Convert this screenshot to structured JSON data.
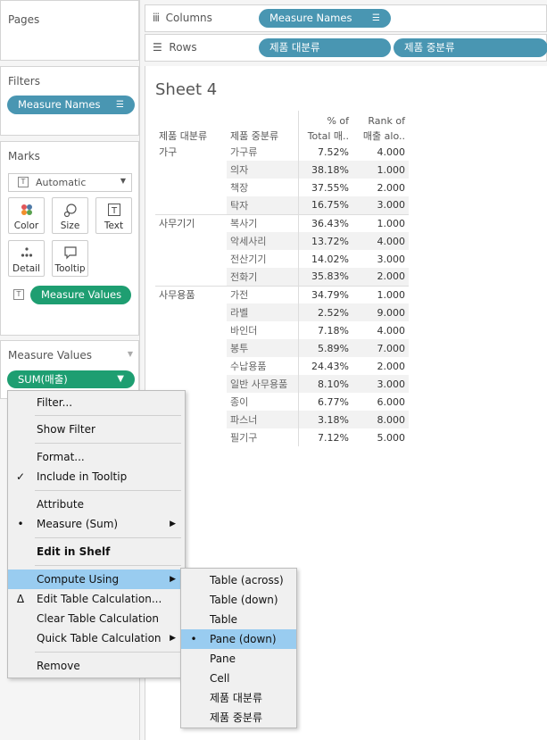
{
  "pages": {
    "title": "Pages"
  },
  "filters": {
    "title": "Filters",
    "pill": "Measure Names"
  },
  "marks": {
    "title": "Marks",
    "type": "Automatic",
    "buttons": {
      "color": "Color",
      "size": "Size",
      "text": "Text",
      "detail": "Detail",
      "tooltip": "Tooltip"
    },
    "text_pill": "Measure Values"
  },
  "measure_values": {
    "title": "Measure Values",
    "pill": "SUM(매출)"
  },
  "columns": {
    "label": "Columns",
    "pill": "Measure Names"
  },
  "rows": {
    "label": "Rows",
    "pills": [
      "제품 대분류",
      "제품 중분류"
    ]
  },
  "sheet": {
    "title": "Sheet 4",
    "headers": {
      "col1": "제품 대분류",
      "col2": "제품 중분류",
      "col3_line1": "% of",
      "col3_line2": "Total 매..",
      "col4_line1": "Rank of",
      "col4_line2": "매출 alo.."
    },
    "rows": [
      {
        "cat": "가구",
        "sub": "가구류",
        "pct": "7.52%",
        "rank": "4.000"
      },
      {
        "cat": "",
        "sub": "의자",
        "pct": "38.18%",
        "rank": "1.000"
      },
      {
        "cat": "",
        "sub": "책장",
        "pct": "37.55%",
        "rank": "2.000"
      },
      {
        "cat": "",
        "sub": "탁자",
        "pct": "16.75%",
        "rank": "3.000"
      },
      {
        "cat": "사무기기",
        "sub": "복사기",
        "pct": "36.43%",
        "rank": "1.000"
      },
      {
        "cat": "",
        "sub": "악세사리",
        "pct": "13.72%",
        "rank": "4.000"
      },
      {
        "cat": "",
        "sub": "전산기기",
        "pct": "14.02%",
        "rank": "3.000"
      },
      {
        "cat": "",
        "sub": "전화기",
        "pct": "35.83%",
        "rank": "2.000"
      },
      {
        "cat": "사무용품",
        "sub": "가전",
        "pct": "34.79%",
        "rank": "1.000"
      },
      {
        "cat": "",
        "sub": "라벨",
        "pct": "2.52%",
        "rank": "9.000"
      },
      {
        "cat": "",
        "sub": "바인더",
        "pct": "7.18%",
        "rank": "4.000"
      },
      {
        "cat": "",
        "sub": "봉투",
        "pct": "5.89%",
        "rank": "7.000"
      },
      {
        "cat": "",
        "sub": "수납용품",
        "pct": "24.43%",
        "rank": "2.000"
      },
      {
        "cat": "",
        "sub": "일반 사무용품",
        "pct": "8.10%",
        "rank": "3.000"
      },
      {
        "cat": "",
        "sub": "종이",
        "pct": "6.77%",
        "rank": "6.000"
      },
      {
        "cat": "",
        "sub": "파스너",
        "pct": "3.18%",
        "rank": "8.000"
      },
      {
        "cat": "",
        "sub": "필기구",
        "pct": "7.12%",
        "rank": "5.000"
      }
    ]
  },
  "context_menu": {
    "items": {
      "filter": "Filter...",
      "show_filter": "Show Filter",
      "format": "Format...",
      "include_tooltip": "Include in Tooltip",
      "attribute": "Attribute",
      "measure_sum": "Measure (Sum)",
      "edit_in_shelf": "Edit in Shelf",
      "compute_using": "Compute Using",
      "edit_table_calc": "Edit Table Calculation...",
      "clear_table_calc": "Clear Table Calculation",
      "quick_table_calc": "Quick Table Calculation",
      "remove": "Remove"
    }
  },
  "submenu": {
    "items": [
      "Table (across)",
      "Table (down)",
      "Table",
      "Pane (down)",
      "Pane",
      "Cell",
      "제품 대분류",
      "제품 중분류"
    ],
    "selected": "Pane (down)"
  },
  "colors": {
    "pill_blue": "#4996b2",
    "pill_green": "#1e9e71",
    "menu_highlight": "#99ccf0"
  }
}
